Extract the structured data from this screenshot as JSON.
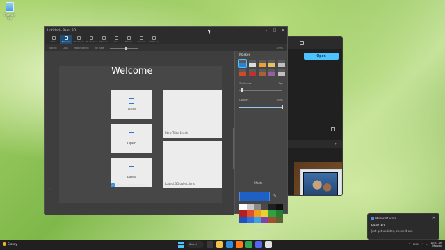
{
  "desktop": {
    "recycle_bin_label": "Recycle Bin"
  },
  "store_window": {
    "open_label": "Open"
  },
  "paint_window": {
    "title": "Untitled - Paint 3D",
    "controls": [
      "–",
      "□",
      "✕"
    ],
    "ribbon_tools": [
      "Menu",
      "Brushes",
      "2D shapes",
      "3D shapes",
      "Stickers",
      "Text",
      "Effects",
      "Canvas",
      "3D library"
    ],
    "subbar": {
      "select": "Select",
      "crop": "Crop",
      "magic_select": "Magic select",
      "view": "3D view",
      "zoom": "100%"
    }
  },
  "welcome": {
    "title": "Welcome",
    "tiles": {
      "new": "New",
      "open": "Open",
      "paste": "Paste",
      "tube_brush": "New Tube Brush",
      "collections": "Latest 3D collections"
    },
    "show_welcome": "Show welcome screen"
  },
  "side_panel": {
    "title": "Marker",
    "thickness_label": "Thickness",
    "thickness_value": "5px",
    "opacity_label": "Opacity",
    "opacity_value": "100%",
    "color_title": "Matte",
    "add_color": "+ Add color",
    "brush_colors": [
      "#2f7fd6",
      "#dcdcdc",
      "#f0a030",
      "#e8c060",
      "#c0c0c0",
      "#d04a2a",
      "#c03030",
      "#b06030",
      "#9060a0",
      "#c0c0c0"
    ],
    "palette_colors": [
      "#ffffff",
      "#c8c8c8",
      "#8a8a8a",
      "#4a4a4a",
      "#202020",
      "#101010",
      "#b02020",
      "#e05030",
      "#f0a020",
      "#e8d030",
      "#30a040",
      "#208030",
      "#2050c0",
      "#3070e0",
      "#40a0e0",
      "#8040b0",
      "#a05030",
      "#606030"
    ],
    "current_color": "#1f60c4"
  },
  "toast": {
    "app": "Microsoft Store",
    "heading": "Paint 3D",
    "body": "Just got updated, check it out."
  },
  "taskbar": {
    "weather": "Cloudy",
    "search_label": "Search",
    "lang": "ENG",
    "time": "10:24 AM",
    "date": "Monday"
  }
}
